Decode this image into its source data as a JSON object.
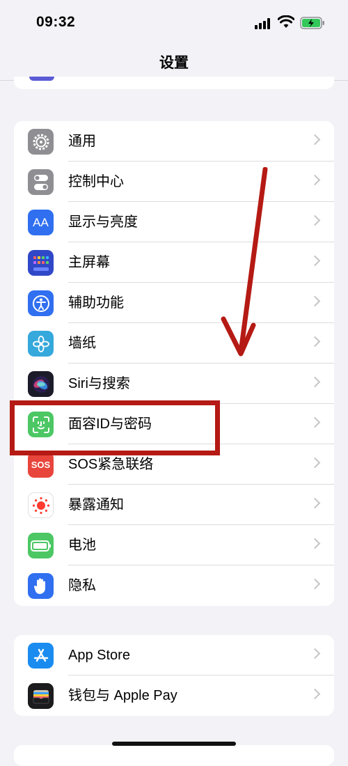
{
  "status_bar": {
    "time": "09:32",
    "battery_color": "#34c759"
  },
  "nav": {
    "title": "设置"
  },
  "group1": {
    "items": [
      {
        "label": "通用",
        "icon": "gear-icon",
        "color": "#8e8e93"
      },
      {
        "label": "控制中心",
        "icon": "toggles-icon",
        "color": "#8e8e93"
      },
      {
        "label": "显示与亮度",
        "icon": "aa-text-icon",
        "icon_text": "AA",
        "color": "#2f6ff0"
      },
      {
        "label": "主屏幕",
        "icon": "home-grid-icon",
        "color": "#3048c8"
      },
      {
        "label": "辅助功能",
        "icon": "accessibility-icon",
        "color": "#2f6ff0"
      },
      {
        "label": "墙纸",
        "icon": "flower-icon",
        "color": "#35a8dc"
      },
      {
        "label": "Siri与搜索",
        "icon": "siri-icon",
        "color": "#1b1b2a"
      },
      {
        "label": "面容ID与密码",
        "icon": "face-id-icon",
        "color": "#4cc764"
      },
      {
        "label": "SOS紧急联络",
        "icon": "sos-icon",
        "icon_text": "SOS",
        "color": "#e8453c"
      },
      {
        "label": "暴露通知",
        "icon": "exposure-icon",
        "color": "#ffffff"
      },
      {
        "label": "电池",
        "icon": "battery-icon",
        "color": "#4cc764"
      },
      {
        "label": "隐私",
        "icon": "hand-icon",
        "color": "#2f6ff0"
      }
    ]
  },
  "group2": {
    "items": [
      {
        "label": "App Store",
        "icon": "app-store-icon",
        "color": "#1a8cf0"
      },
      {
        "label": "钱包与 Apple Pay",
        "icon": "wallet-icon",
        "color": "#1c1c1e"
      }
    ]
  },
  "annotation": {
    "color": "#b51a14"
  }
}
